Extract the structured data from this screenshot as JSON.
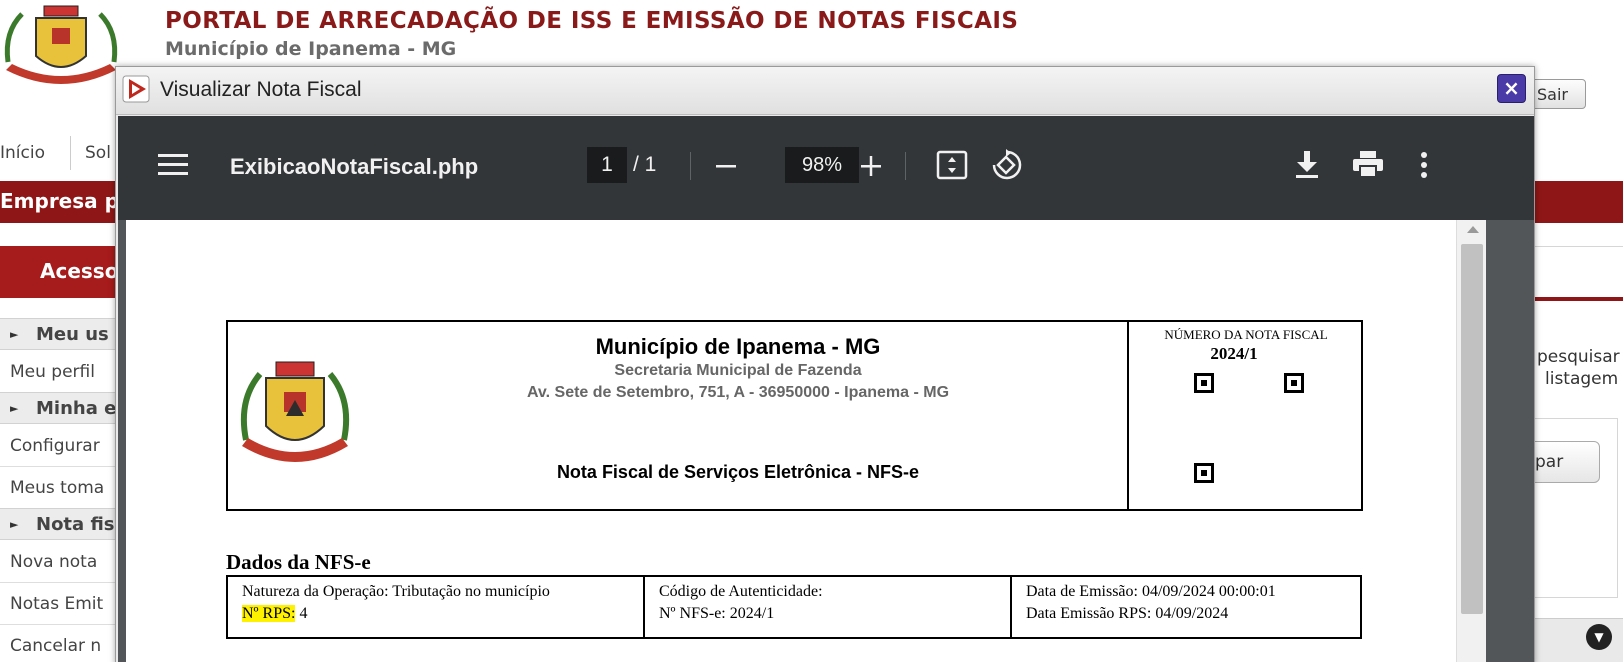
{
  "portal": {
    "title": "PORTAL DE ARRECADAÇÃO DE ISS E EMISSÃO DE NOTAS FISCAIS",
    "subtitle": "Município de Ipanema - MG",
    "logout_label": "Sair"
  },
  "topnav": {
    "items": [
      "Início",
      "Sol"
    ]
  },
  "banner": {
    "text": "Empresa p"
  },
  "sidebar": {
    "access_label": "Acesso",
    "sections": [
      {
        "title": "Meu us",
        "links": [
          "Meu perfil"
        ]
      },
      {
        "title": "Minha e",
        "links": [
          "Configurar",
          "Meus toma"
        ]
      },
      {
        "title": "Nota fis",
        "links": [
          "Nova nota",
          "Notas Emit",
          "Cancelar n"
        ]
      }
    ]
  },
  "right_panel": {
    "text_line1": "pesquisar",
    "text_line2": "listagem",
    "button_label": "par"
  },
  "modal": {
    "title": "Visualizar Nota Fiscal",
    "close_label": "×"
  },
  "pdf_viewer": {
    "filename": "ExibicaoNotaFiscal.php",
    "current_page": "1",
    "total_pages": "/  1",
    "zoom": "98%"
  },
  "invoice": {
    "municipality": "Município de Ipanema - MG",
    "department": "Secretaria Municipal de Fazenda",
    "address": "Av. Sete de Setembro, 751, A - 36950000 - Ipanema - MG",
    "document_type": "Nota Fiscal de Serviços Eletrônica - NFS-e",
    "number_label": "NÚMERO DA NOTA FISCAL",
    "number": "2024/1",
    "section_title": "Dados da NFS-e",
    "cells": {
      "natureza": "Natureza da Operação: Tributação no município",
      "rps_label": "Nº RPS:",
      "rps_value": " 4",
      "codigo": "Código de Autenticidade:",
      "nfse_num": "Nº NFS-e: 2024/1",
      "data_emissao": "Data de Emissão: 04/09/2024 00:00:01",
      "data_rps": "Data Emissão RPS: 04/09/2024"
    }
  },
  "colors": {
    "brand_red": "#8f1616",
    "pdf_toolbar": "#323639",
    "highlight": "#fff200",
    "close_button": "#4a3aa8"
  },
  "icons": [
    "menu-icon",
    "zoom-out-icon",
    "zoom-in-icon",
    "fit-page-icon",
    "rotate-icon",
    "download-icon",
    "print-icon",
    "more-vert-icon",
    "play-icon",
    "close-icon",
    "chevron-down-icon"
  ]
}
